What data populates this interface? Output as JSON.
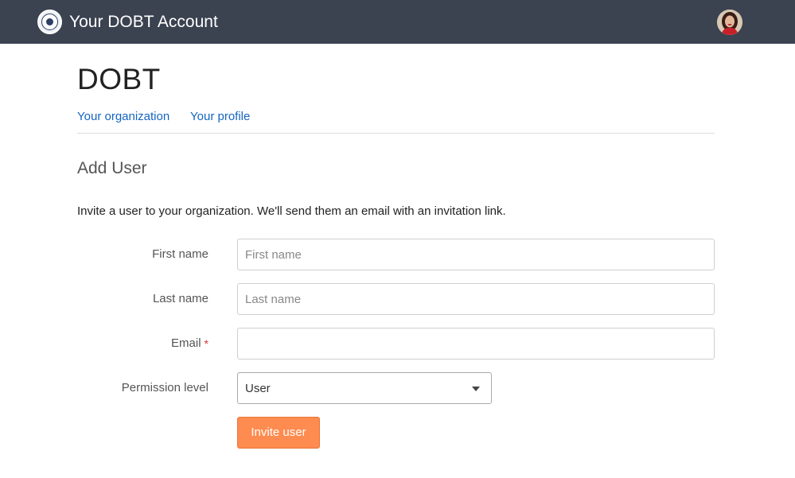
{
  "header": {
    "app_title": "Your DOBT Account",
    "logo_icon": "seal-icon",
    "avatar_icon": "user-avatar",
    "background_color": "#3b4250"
  },
  "page": {
    "org_title": "DOBT",
    "nav": [
      {
        "label": "Your organization"
      },
      {
        "label": "Your profile"
      }
    ],
    "link_color": "#1565c0"
  },
  "form": {
    "section_title": "Add User",
    "intro": "Invite a user to your organization. We'll send them an email with an invitation link.",
    "first_name": {
      "label": "First name",
      "placeholder": "First name",
      "value": ""
    },
    "last_name": {
      "label": "Last name",
      "placeholder": "Last name",
      "value": ""
    },
    "email": {
      "label": "Email",
      "required_mark": "*",
      "placeholder": "",
      "value": ""
    },
    "permission": {
      "label": "Permission level",
      "value": "User"
    },
    "submit_label": "Invite user",
    "submit_color": "#fe8b4f"
  }
}
